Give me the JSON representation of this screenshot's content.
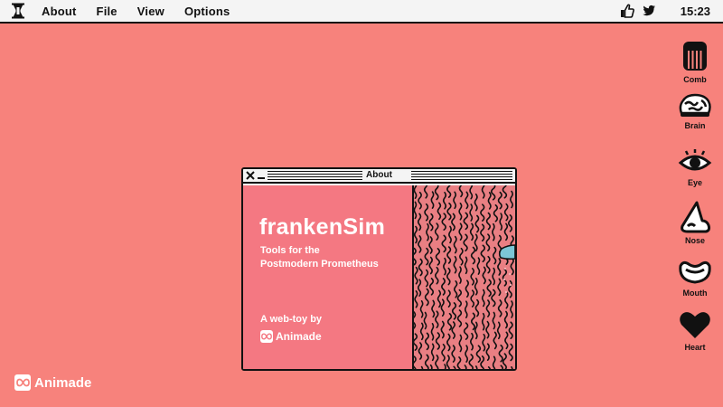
{
  "menubar": {
    "logo_icon": "frankensim-logo-icon",
    "menus": [
      {
        "id": "about",
        "label": "About"
      },
      {
        "id": "file",
        "label": "File"
      },
      {
        "id": "view",
        "label": "View"
      },
      {
        "id": "options",
        "label": "Options"
      }
    ],
    "right_icons": [
      "thumbs-up-icon",
      "twitter-icon"
    ],
    "clock": "15:23"
  },
  "dock": {
    "items": [
      {
        "id": "comb",
        "label": "Comb",
        "icon": "comb-icon"
      },
      {
        "id": "brain",
        "label": "Brain",
        "icon": "brain-icon"
      },
      {
        "id": "eye",
        "label": "Eye",
        "icon": "eye-icon"
      },
      {
        "id": "nose",
        "label": "Nose",
        "icon": "nose-icon"
      },
      {
        "id": "mouth",
        "label": "Mouth",
        "icon": "mouth-icon"
      },
      {
        "id": "heart",
        "label": "Heart",
        "icon": "heart-icon"
      }
    ]
  },
  "about_window": {
    "title": "About",
    "app_name": "frankenSim",
    "tagline_line1": "Tools for the",
    "tagline_line2": "Postmodern Prometheus",
    "byline": "A web-toy by",
    "credit": "Animade"
  },
  "footer": {
    "brand": "Animade"
  },
  "colors": {
    "background": "#f7827c",
    "menubar": "#f4f4f4",
    "window_panel": "#f47882",
    "hair_panel": "#e97f83",
    "ink": "#111111",
    "accent_blue": "#7cc6d6"
  }
}
